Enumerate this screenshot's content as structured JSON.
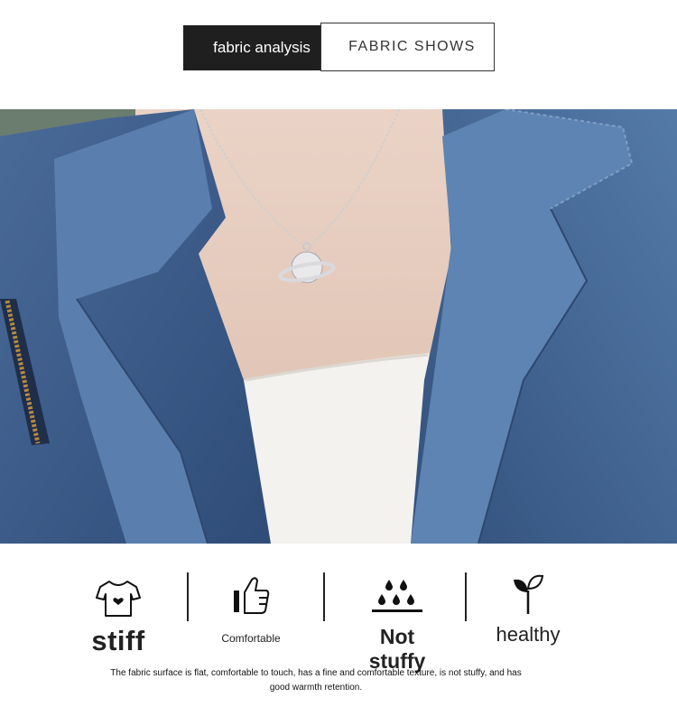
{
  "header": {
    "tab_primary": "fabric analysis",
    "tab_secondary": "FABRIC SHOWS"
  },
  "photo": {
    "subject": "denim-jacket-necklace",
    "colors": {
      "denim": "#3f5f8c",
      "skin": "#e6cbbb",
      "shirt": "#f4f2ef"
    }
  },
  "features": [
    {
      "label": "stiff",
      "icon": "tshirt-heart-icon"
    },
    {
      "label": "Comfortable",
      "icon": "thumbs-up-icon"
    },
    {
      "label": "Not stuffy",
      "icon": "droplets-icon"
    },
    {
      "label": "healthy",
      "icon": "sprout-icon"
    }
  ],
  "description": "The fabric surface is flat, comfortable to touch, has a fine and comfortable texture, is not stuffy, and has good warmth retention."
}
